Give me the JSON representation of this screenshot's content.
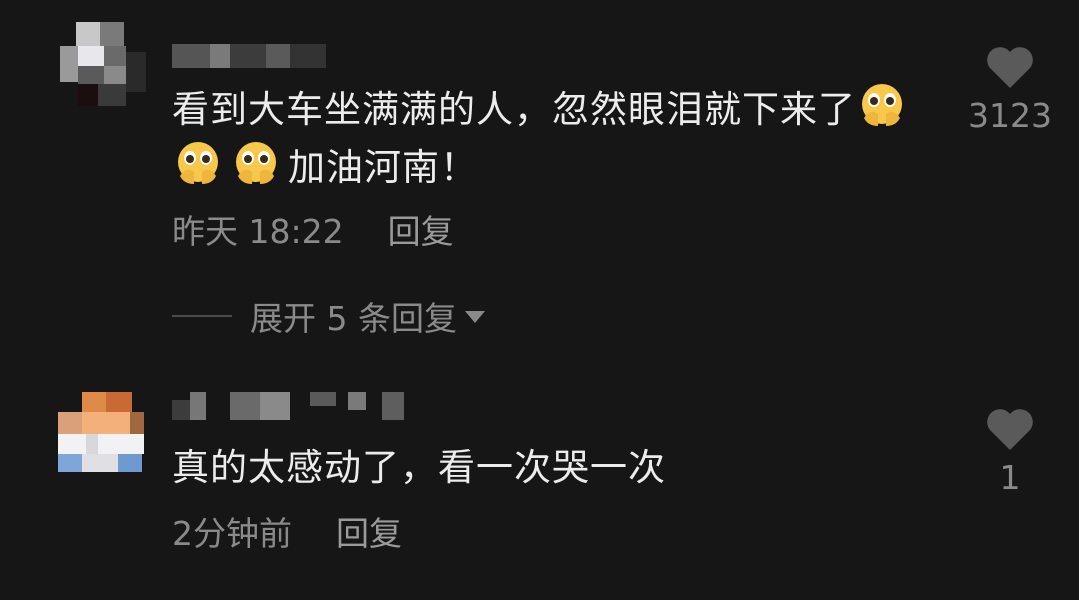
{
  "comments": [
    {
      "text": "看到大车坐满满的人，忽然眼泪就下来了",
      "tail": "加油河南！",
      "emoji": [
        "pleading-face-hands-over-mouth",
        "pleading-face-hands-over-mouth",
        "pleading-face-hands-over-mouth"
      ],
      "time": "昨天 18:22",
      "reply": "回复",
      "likes": "3123"
    },
    {
      "text": "真的太感动了，看一次哭一次",
      "time": "2分钟前",
      "reply": "回复",
      "likes": "1"
    }
  ],
  "expand_label": "展开 5 条回复",
  "colors": {
    "background": "#161616",
    "text": "#ececec",
    "meta": "#8a8a8a",
    "heart": "#5a5a5a"
  }
}
